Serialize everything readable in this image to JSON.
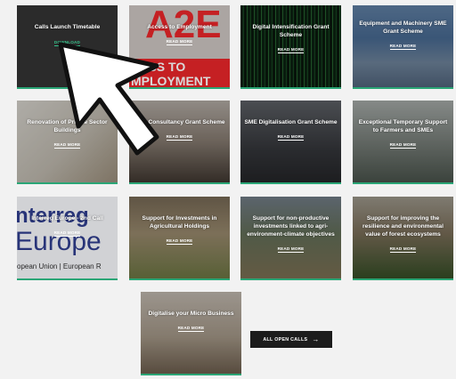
{
  "tiles": [
    {
      "title": "Calls Launch Timetable",
      "link": "DOWNLOAD"
    },
    {
      "title": "Access to Employment",
      "link": "READ MORE",
      "bg_text": "A2E",
      "bg_text2": "CESS TO",
      "bg_text3": "MPLOYMENT"
    },
    {
      "title": "Digital Intensification Grant Scheme",
      "link": "READ MORE"
    },
    {
      "title": "Equipment and Machinery SME Grant Scheme",
      "link": "READ MORE"
    },
    {
      "title": "Renovation of Private Sector Buildings",
      "link": "READ MORE"
    },
    {
      "title": "SME Consultancy Grant Scheme",
      "link": "READ MORE"
    },
    {
      "title": "SME Digitalisation Grant Scheme",
      "link": "READ MORE"
    },
    {
      "title": "Exceptional Temporary Support to Farmers and SMEs",
      "link": "READ MORE"
    },
    {
      "title": "Interreg Europe - 2nd Call",
      "link": "READ MORE",
      "bg_text": "nterreg",
      "bg_text2": "Europe",
      "bg_text3": "opean Union | European R"
    },
    {
      "title": "Support for Investments in Agricultural Holdings",
      "link": "READ MORE"
    },
    {
      "title": "Support for non-productive investments linked to agri-environment-climate objectives",
      "link": "READ MORE"
    },
    {
      "title": "Support for improving the resilience and environmental value of forest ecosystems",
      "link": "READ MORE"
    },
    {
      "title": "Digitalise your Micro Business",
      "link": "READ MORE"
    }
  ],
  "all_calls": {
    "label": "ALL OPEN CALLS",
    "icon": "arrow-right-icon"
  },
  "colors": {
    "accent": "#2aa676",
    "button": "#1c1c1c",
    "a2e_red": "#e8262a"
  }
}
